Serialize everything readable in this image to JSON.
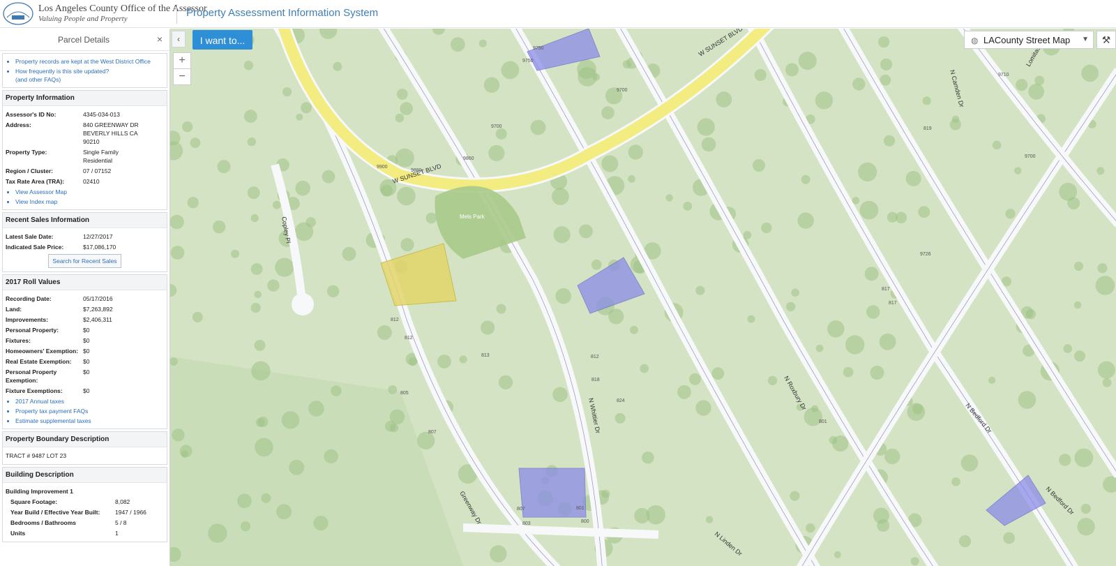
{
  "header": {
    "org_name": "Los Angeles County Office of the Assessor",
    "tagline": "Valuing People and Property",
    "app_title": "Property Assessment Information System"
  },
  "panel": {
    "title": "Parcel Details",
    "close_label": "×",
    "faq_links": [
      "Property records are kept at the West District Office",
      "How frequently is this site updated?",
      "(and other FAQs)"
    ],
    "property_info": {
      "heading": "Property Information",
      "rows": [
        {
          "label": "Assessor's ID No:",
          "value": "4345-034-013"
        },
        {
          "label": "Address:",
          "value": "840 GREENWAY DR",
          "value2": "BEVERLY HILLS CA",
          "value3": "90210"
        },
        {
          "label": "Property Type:",
          "value": "Single Family",
          "value2": "Residential"
        },
        {
          "label": "Region / Cluster:",
          "value": "07 / 07152"
        },
        {
          "label": "Tax Rate Area (TRA):",
          "value": "02410"
        }
      ],
      "links": [
        "View Assessor Map",
        "View Index map"
      ]
    },
    "sales": {
      "heading": "Recent Sales Information",
      "latest_label": "Latest Sale Date:",
      "latest_value": "12/27/2017",
      "price_label": "Indicated Sale Price:",
      "price_value": "$17,086,170",
      "search_button": "Search for Recent Sales"
    },
    "roll": {
      "heading": "2017 Roll Values",
      "rows": [
        {
          "label": "Recording Date:",
          "value": "05/17/2016"
        },
        {
          "label": "Land:",
          "value": "$7,263,892"
        },
        {
          "label": "Improvements:",
          "value": "$2,406,311"
        },
        {
          "label": "Personal Property:",
          "value": "$0"
        },
        {
          "label": "Fixtures:",
          "value": "$0"
        },
        {
          "label": "Homeowners' Exemption:",
          "value": "$0"
        },
        {
          "label": "Real Estate Exemption:",
          "value": "$0"
        },
        {
          "label": "Personal Property Exemption:",
          "value": "$0"
        },
        {
          "label": "Fixture Exemptions:",
          "value": "$0"
        }
      ],
      "links": [
        "2017 Annual taxes",
        "Property tax payment FAQs",
        "Estimate supplemental taxes"
      ]
    },
    "boundary": {
      "heading": "Property Boundary Description",
      "text": "TRACT # 9487 LOT 23"
    },
    "building": {
      "heading": "Building Description",
      "subheading": "Building Improvement 1",
      "rows": [
        {
          "label": "Square Footage:",
          "value": "8,082"
        },
        {
          "label": "Year Build / Effective Year Built:",
          "value": "1947 / 1966"
        },
        {
          "label": "Bedrooms / Bathrooms",
          "value": "5 / 8"
        },
        {
          "label": "Units",
          "value": "1"
        }
      ]
    }
  },
  "map": {
    "i_want_to": "I want to...",
    "basemap_label": "LACounty Street Map",
    "zoom_in": "+",
    "zoom_out": "−",
    "collapse_label": "‹",
    "colors": {
      "ground": "#d4e3c4",
      "street": "#f7f8fa",
      "sunset": "#f3ec80",
      "parcel_line": "#7d74a8",
      "highlight": "#e3d56a",
      "blue": "#8b8de8",
      "park": "#a8c98a"
    },
    "street_labels": [
      "W SUNSET BLVD",
      "W SUNSET BLVD",
      "Copley Pl",
      "N Whittier Dr",
      "Greenway Dr",
      "N Roxbury Dr",
      "N Linden Dr",
      "N Bedford Dr",
      "N Bedford Dr",
      "N Camden Dr",
      "Lomitas Av"
    ],
    "park_label": "Mels Park",
    "house_numbers": [
      "9900",
      "9880",
      "9860",
      "9750",
      "9750",
      "9700",
      "9700",
      "812",
      "812",
      "813",
      "805",
      "807",
      "807",
      "803",
      "800",
      "801",
      "801",
      "812",
      "818",
      "824",
      "817",
      "9726",
      "9700",
      "817",
      "819",
      "9710"
    ]
  }
}
